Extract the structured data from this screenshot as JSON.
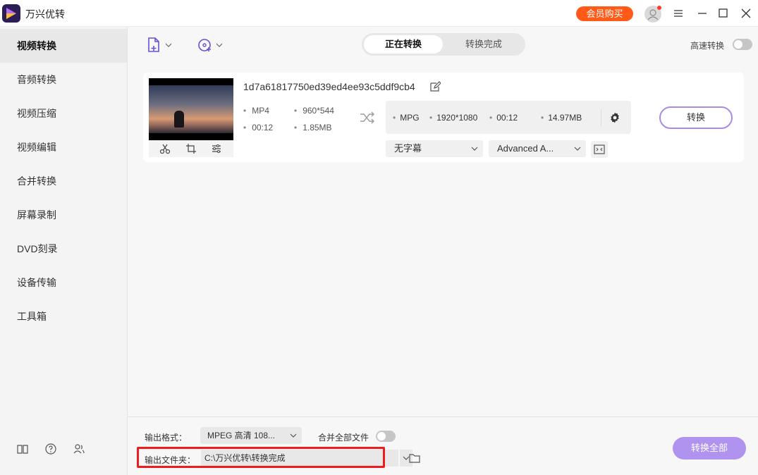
{
  "app": {
    "title": "万兴优转",
    "vip_label": "会员购买"
  },
  "sidebar": {
    "items": [
      {
        "label": "视频转换",
        "active": true
      },
      {
        "label": "音频转换"
      },
      {
        "label": "视频压缩"
      },
      {
        "label": "视频编辑"
      },
      {
        "label": "合并转换"
      },
      {
        "label": "屏幕录制"
      },
      {
        "label": "DVD刻录"
      },
      {
        "label": "设备传输"
      },
      {
        "label": "工具箱"
      }
    ]
  },
  "toolbar": {
    "tabs": [
      {
        "label": "正在转换",
        "active": true
      },
      {
        "label": "转换完成"
      }
    ],
    "speed_label": "高速转换"
  },
  "file": {
    "name": "1d7a61817750ed39ed4ee93c5ddf9cb4",
    "source": {
      "format": "MP4",
      "resolution": "960*544",
      "duration": "00:12",
      "size": "1.85MB"
    },
    "output": {
      "format": "MPG",
      "resolution": "1920*1080",
      "duration": "00:12",
      "size": "14.97MB"
    },
    "subtitle": "无字幕",
    "audio": "Advanced A...",
    "convert_label": "转换"
  },
  "footer": {
    "format_label": "输出格式：",
    "format_value": "MPEG 高清 108...",
    "merge_label": "合并全部文件",
    "folder_label": "输出文件夹：",
    "folder_path": "C:\\万兴优转\\转换完成",
    "convert_all_label": "转换全部"
  },
  "colors": {
    "accent": "#a98be6",
    "vip": "#ff5a17",
    "highlight": "#ee1d1d"
  }
}
